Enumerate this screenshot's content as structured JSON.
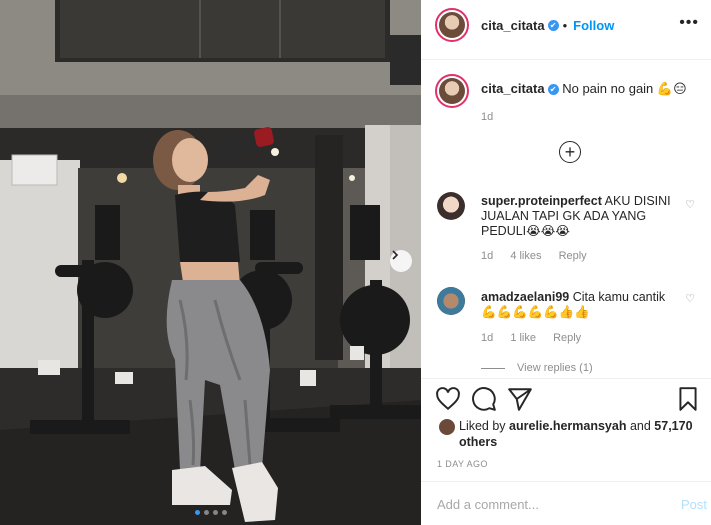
{
  "post": {
    "username": "cita_citata",
    "verified_mark": "✔",
    "follow_label": "Follow",
    "more_label": "•••",
    "caption_text": "No pain no gain 💪😑",
    "caption_time": "1d",
    "load_more_icon": "+",
    "photo_dots": 4,
    "photo_active_dot": 1
  },
  "comments": [
    {
      "username": "super.proteinperfect",
      "text": "AKU DISINI JUALAN TAPI GK ADA YANG PEDULI😭😭😭",
      "time": "1d",
      "likes": "4 likes",
      "reply": "Reply",
      "avatar_color": "#c9b2a2"
    },
    {
      "username": "amadzaelani99",
      "text": "Cita kamu cantik 💪💪💪💪💪👍👍",
      "time": "1d",
      "likes": "1 like",
      "reply": "Reply",
      "avatar_color": "#5b4a3f"
    }
  ],
  "view_replies": "View replies (1)",
  "likes": {
    "prefix": "Liked by",
    "user": "aurelie.hermansyah",
    "and": "and",
    "count": "57,170 others"
  },
  "time_ago": "1 DAY AGO",
  "add_comment_placeholder": "Add a comment...",
  "post_label": "Post",
  "icons": {
    "like": "heart-icon",
    "comment": "comment-icon",
    "share": "share-icon",
    "save": "bookmark-icon",
    "more": "more-options-icon",
    "add": "plus-circle-icon",
    "next": "chevron-right-icon"
  },
  "colors": {
    "accent": "#0095f6",
    "verified": "#3897f0",
    "muted": "#8e8e8e",
    "ring": "#e1306c"
  }
}
